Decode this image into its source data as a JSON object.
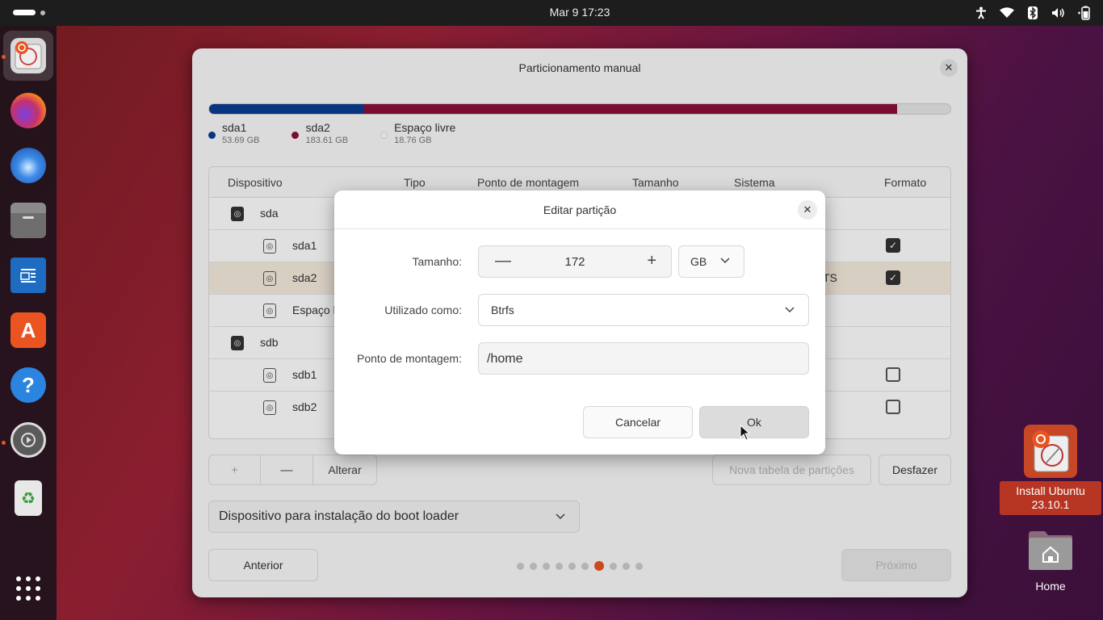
{
  "topbar": {
    "clock": "Mar 9  17:23",
    "tray_icons": [
      "accessibility-icon",
      "wifi-icon",
      "bluetooth-icon",
      "volume-icon",
      "battery-icon"
    ]
  },
  "dock": {
    "apps": [
      "Install Ubuntu",
      "Firefox",
      "Thunderbird",
      "Files",
      "LibreOffice Writer",
      "App Center",
      "Help",
      "Settings",
      "Trash",
      "Show Apps"
    ]
  },
  "installer": {
    "title": "Particionamento manual",
    "legend": [
      {
        "name": "sda1",
        "size": "53.69 GB",
        "color": "#0a3d91"
      },
      {
        "name": "sda2",
        "size": "183.61 GB",
        "color": "#8c0f3a"
      },
      {
        "name": "Espaço livre",
        "size": "18.76 GB",
        "color": "#ffffff"
      }
    ],
    "columns": {
      "device": "Dispositivo",
      "type": "Tipo",
      "mount": "Ponto de montagem",
      "size": "Tamanho",
      "system": "Sistema",
      "format": "Formato"
    },
    "rows": [
      {
        "name": "sda",
        "level": 0,
        "system": "",
        "format": null
      },
      {
        "name": "sda1",
        "level": 1,
        "system": "",
        "format": true
      },
      {
        "name": "sda2",
        "level": 1,
        "system": "TS",
        "format": true
      },
      {
        "name": "Espaço l",
        "level": 1,
        "system": "",
        "format": null
      },
      {
        "name": "sdb",
        "level": 0,
        "system": "",
        "format": null
      },
      {
        "name": "sdb1",
        "level": 1,
        "system": "",
        "format": false
      },
      {
        "name": "sdb2",
        "level": 1,
        "system": "",
        "format": false
      }
    ],
    "toolbar": {
      "add": "+",
      "remove": "—",
      "change": "Alterar"
    },
    "new_table": "Nova tabela de partições",
    "undo": "Desfazer",
    "bootloader": "Dispositivo para instalação do boot loader",
    "back": "Anterior",
    "next": "Próximo",
    "progress": {
      "total_steps": 10,
      "current_step": 7
    }
  },
  "dialog": {
    "title": "Editar partição",
    "size_label": "Tamanho:",
    "size_value": "172",
    "unit": "GB",
    "use_label": "Utilizado como:",
    "use_value": "Btrfs",
    "mount_label": "Ponto de montagem:",
    "mount_value": "/home",
    "cancel": "Cancelar",
    "ok": "Ok"
  },
  "desktop": {
    "install_label_line1": "Install Ubuntu",
    "install_label_line2": "23.10.1",
    "home_label": "Home"
  }
}
